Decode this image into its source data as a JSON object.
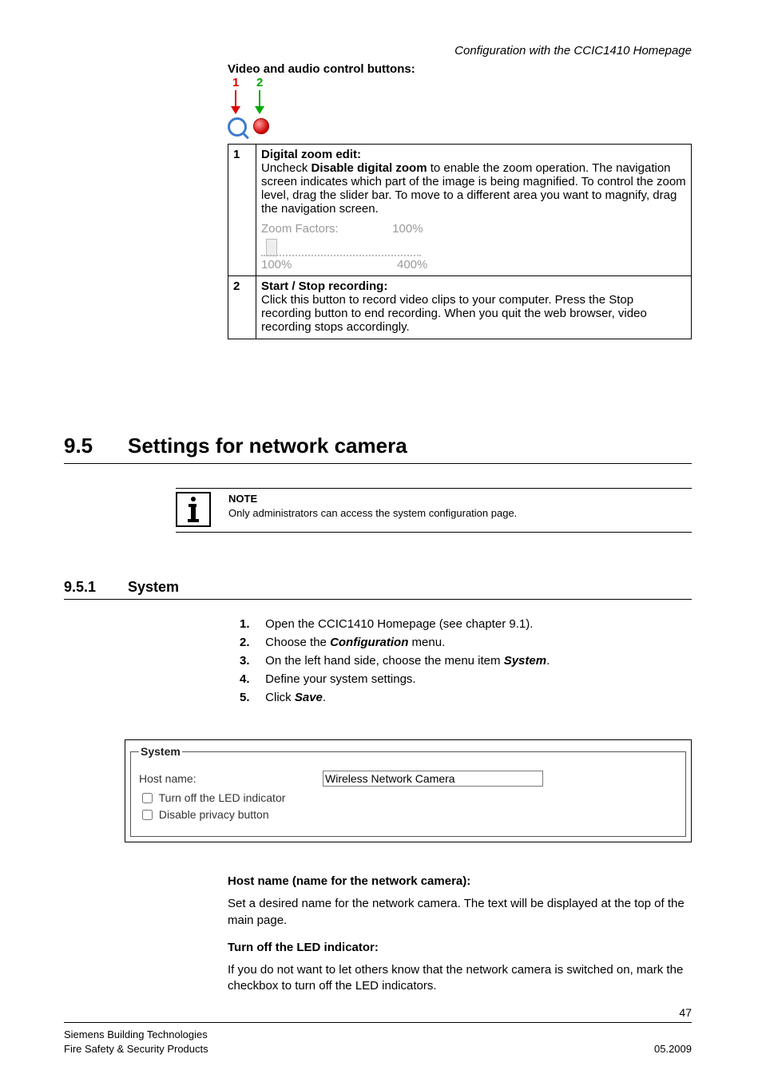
{
  "header": {
    "right": "Configuration with the CCIC1410 Homepage"
  },
  "vac": {
    "heading": "Video and audio control buttons:",
    "callout": {
      "label1": "1",
      "label2": "2"
    }
  },
  "desc_table": {
    "row1": {
      "num": "1",
      "title": "Digital zoom edit:",
      "text_pre": "Uncheck ",
      "bold": "Disable digital zoom",
      "text_post": " to enable the zoom operation. The navigation screen indicates which part of the image is being magnified. To control the zoom level, drag the slider bar. To move to a different area you want to magnify, drag the navigation screen.",
      "zoom": {
        "label": "Zoom Factors:",
        "value": "100%",
        "min": "100%",
        "max": "400%"
      }
    },
    "row2": {
      "num": "2",
      "title": "Start / Stop recording:",
      "text": "Click this button to record video clips to your computer. Press the Stop recording button to end recording. When you quit the web browser, video recording stops accordingly."
    }
  },
  "sec95": {
    "num": "9.5",
    "title": "Settings for network camera"
  },
  "note": {
    "title": "NOTE",
    "text": "Only administrators can access the system configuration page."
  },
  "sec951": {
    "num": "9.5.1",
    "title": "System"
  },
  "steps": [
    {
      "n": "1.",
      "t": "Open the CCIC1410 Homepage (see chapter 9.1)."
    },
    {
      "n": "2.",
      "pre": "Choose the ",
      "bi": "Configuration",
      "post": " menu."
    },
    {
      "n": "3.",
      "pre": "On the left hand side, choose the menu item ",
      "bi": "System",
      "post": "."
    },
    {
      "n": "4.",
      "t": "Define your system settings."
    },
    {
      "n": "5.",
      "pre": "Click ",
      "bi": "Save",
      "post": "."
    }
  ],
  "system_fs": {
    "legend": "System",
    "hostname_label": "Host name:",
    "hostname_value": "Wireless Network Camera",
    "led_label": "Turn off the LED indicator",
    "privacy_label": "Disable privacy button"
  },
  "below": {
    "h1": "Host name (name for the network camera):",
    "p1": "Set a desired name for the network camera. The text will be displayed at the top of the main page.",
    "h2": "Turn off the LED indicator:",
    "p2": "If you do not want to let others know that the network camera is switched on, mark the checkbox to turn off the LED indicators."
  },
  "footer": {
    "pagenum": "47",
    "l1": "Siemens Building Technologies",
    "l2": "Fire Safety & Security Products",
    "r": "05.2009"
  }
}
